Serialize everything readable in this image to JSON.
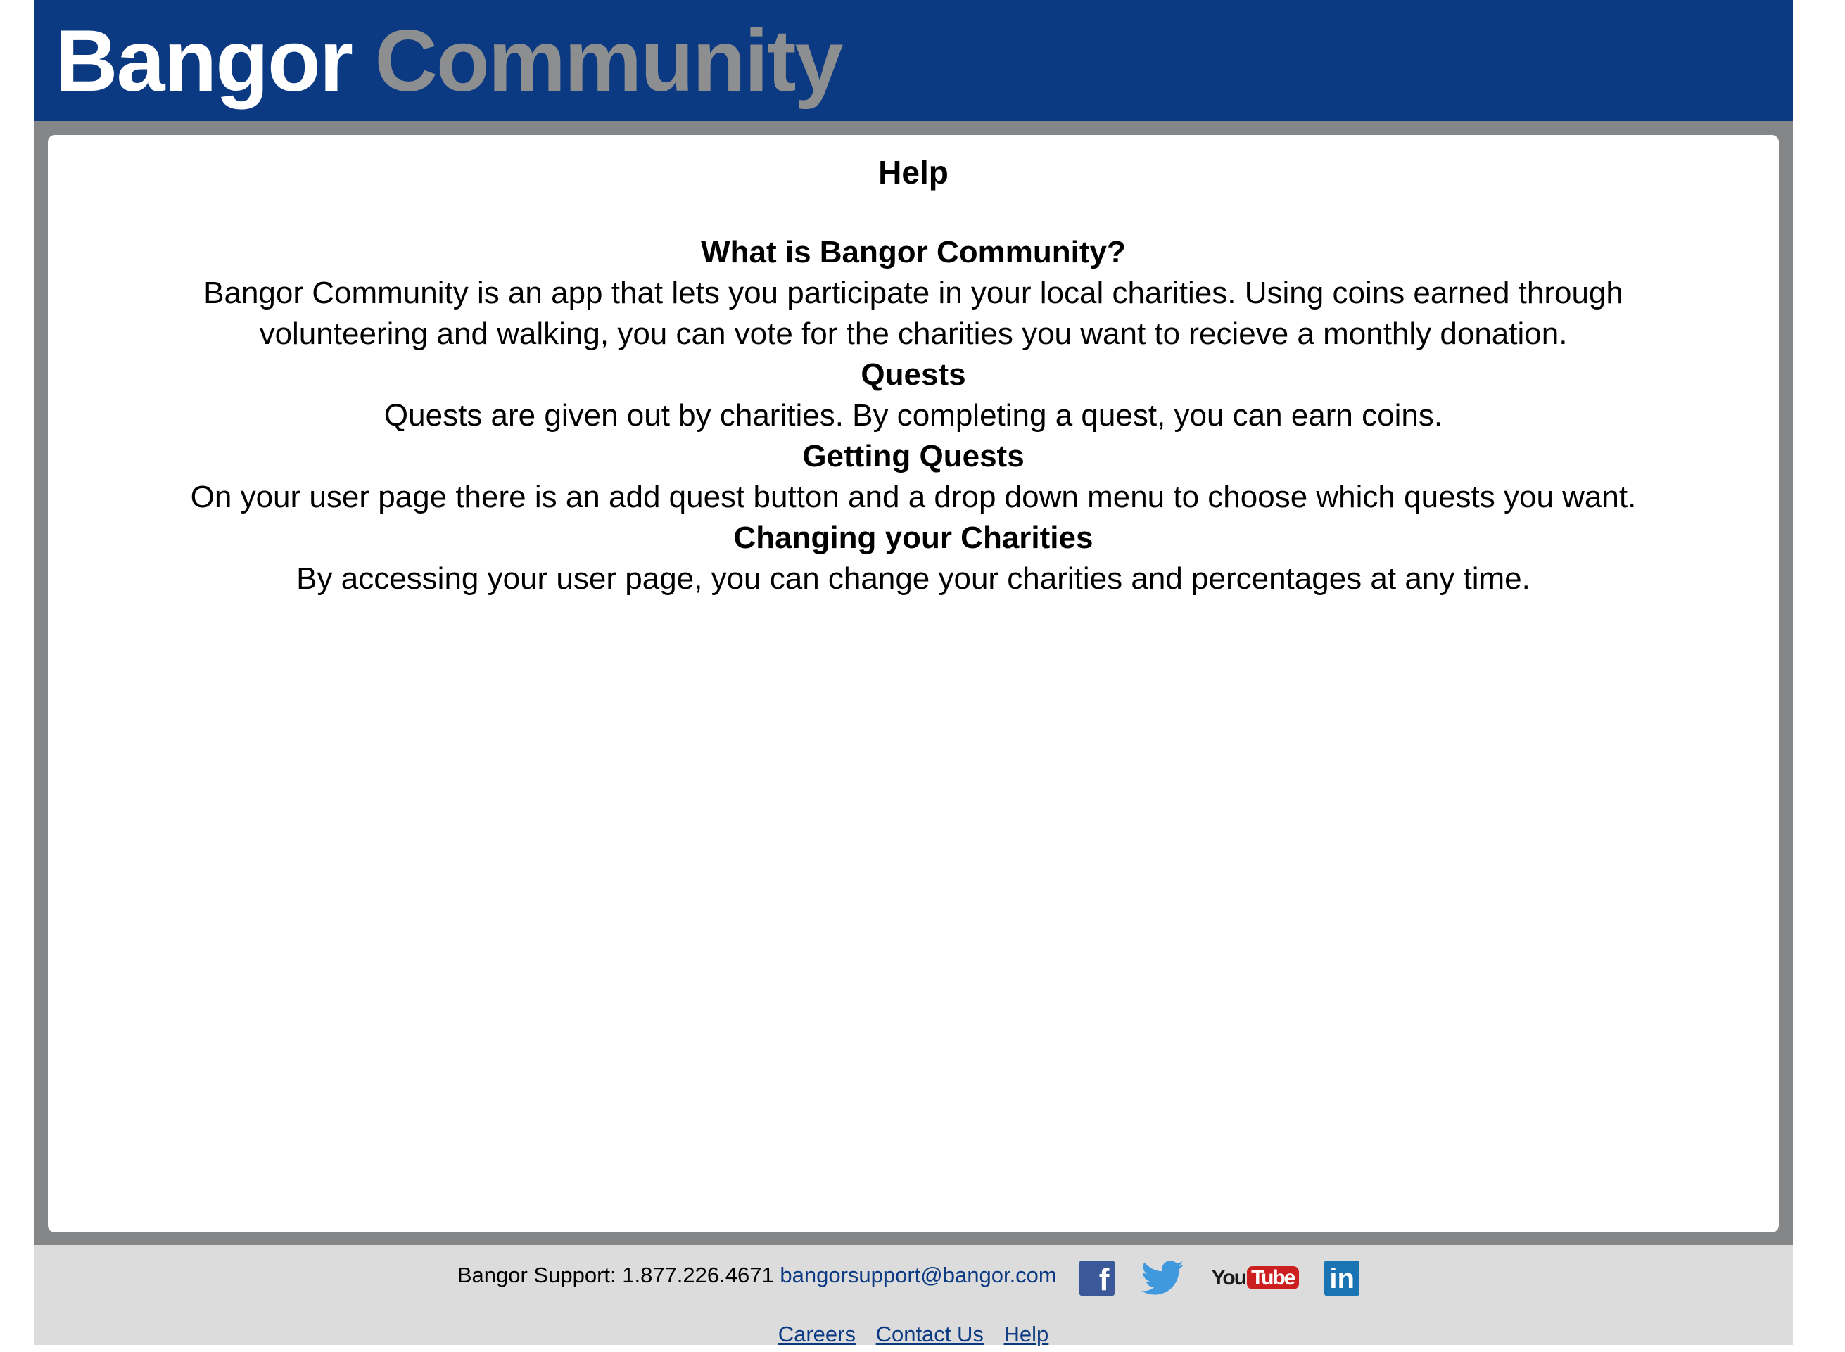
{
  "header": {
    "brand_part1": "Bangor",
    "brand_part2": "Community"
  },
  "main": {
    "title": "Help",
    "sections": [
      {
        "heading": "What is Bangor Community?",
        "lines": [
          "Bangor Community is an app that lets you participate in your local charities. Using coins earned through",
          "volunteering and walking, you can vote for the charities you want to recieve a monthly donation."
        ]
      },
      {
        "heading": "Quests",
        "lines": [
          "Quests are given out by charities. By completing a quest, you can earn coins."
        ]
      },
      {
        "heading": "Getting Quests",
        "lines": [
          "On your user page there is an add quest button and a drop down menu to choose which quests you want."
        ]
      },
      {
        "heading": "Changing your Charities",
        "lines": [
          "By accessing your user page, you can change your charities and percentages at any time."
        ]
      }
    ]
  },
  "footer": {
    "support_label": "Bangor Support: 1.877.226.4671",
    "support_email": "bangorsupport@bangor.com",
    "social": {
      "facebook_glyph": "f",
      "youtube_you": "You",
      "youtube_tube": "Tube",
      "linkedin_glyph": "in"
    },
    "links": [
      "Careers",
      "Contact Us",
      "Help"
    ]
  },
  "colors": {
    "header_bg": "#0b3a83",
    "brand_secondary": "#8d8e90",
    "frame_gray": "#858688",
    "footer_bg": "#dcdcdd",
    "link": "#0b3a83"
  }
}
